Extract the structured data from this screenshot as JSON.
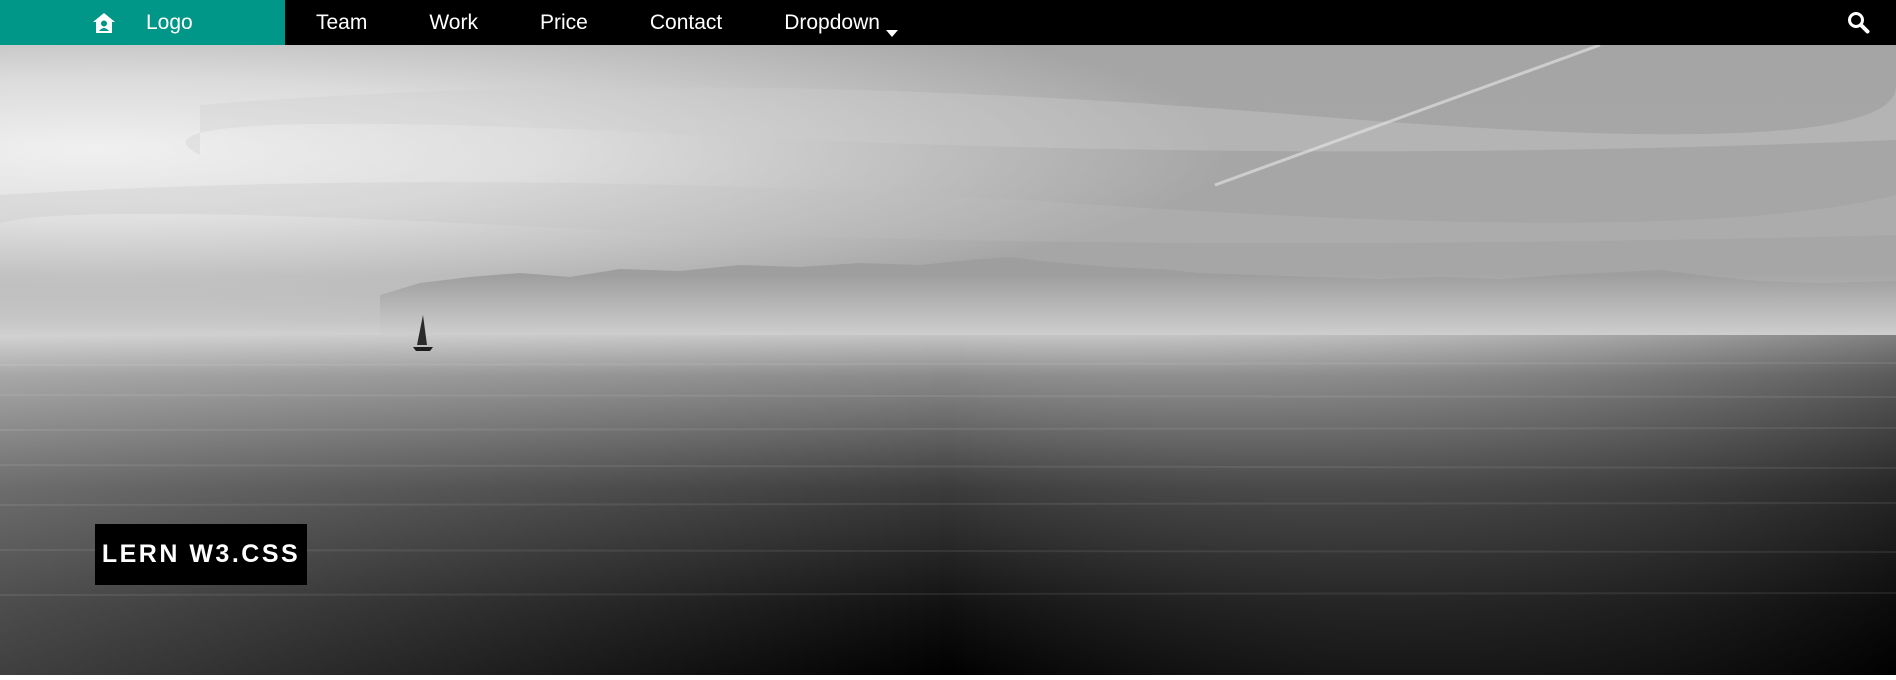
{
  "navbar": {
    "logo_icon": "home-icon",
    "logo_label": "Logo",
    "items": [
      {
        "label": "Team"
      },
      {
        "label": "Work"
      },
      {
        "label": "Price"
      },
      {
        "label": "Contact"
      }
    ],
    "dropdown_label": "Dropdown",
    "dropdown_icon": "caret-down-icon",
    "search_icon": "search-icon",
    "colors": {
      "bar": "#000000",
      "logo_bg": "#009688",
      "text": "#ffffff"
    }
  },
  "hero": {
    "image": "grayscale-sea-sailboat-mountains",
    "badge_text": "LERN W3.CSS"
  }
}
